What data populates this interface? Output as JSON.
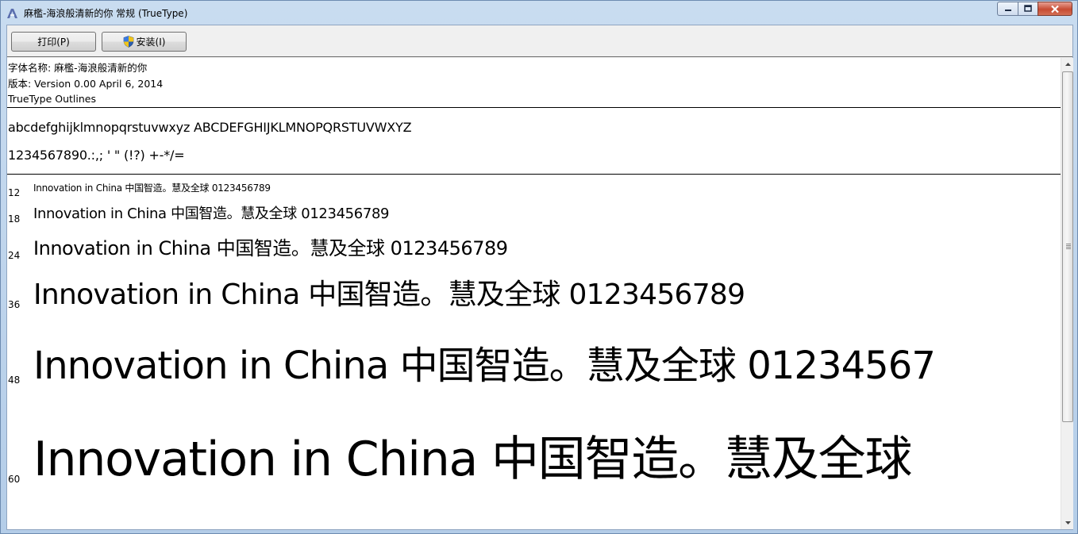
{
  "window": {
    "title": "麻檻-海浪般清新的你 常规 (TrueType)",
    "app_icon": "font-viewer-icon"
  },
  "toolbar": {
    "print_label": "打印(P)",
    "install_label": "安装(I)",
    "install_icon": "uac-shield-icon"
  },
  "font_info": {
    "name_line": "字体名称: 麻檻-海浪般清新的你",
    "version_line": "版本: Version 0.00 April 6, 2014",
    "outline_line": "TrueType Outlines"
  },
  "character_set": {
    "letters": "abcdefghijklmnopqrstuvwxyz ABCDEFGHIJKLMNOPQRSTUVWXYZ",
    "digits_symbols": "1234567890.:,; ' \" (!?) +-*/="
  },
  "samples": [
    {
      "size": "12",
      "latin": "Innovation in China ",
      "cn1": "中国智造",
      "mark": "。",
      "cn2": "慧及全球",
      "digits": " 0123456789"
    },
    {
      "size": "18",
      "latin": "Innovation in China ",
      "cn1": "中国智造",
      "mark": "。",
      "cn2": "慧及全球",
      "digits": " 0123456789"
    },
    {
      "size": "24",
      "latin": "Innovation in China ",
      "cn1": "中国智造",
      "mark": "。",
      "cn2": "慧及全球",
      "digits": " 0123456789"
    },
    {
      "size": "36",
      "latin": "Innovation in China ",
      "cn1": "中国智造",
      "mark": "。",
      "cn2": "慧及全球",
      "digits": " 0123456789"
    },
    {
      "size": "48",
      "latin": "Innovation in China ",
      "cn1": "中国智造",
      "mark": "。",
      "cn2": "慧及全球",
      "digits": " 01234567"
    },
    {
      "size": "60",
      "latin": "Innovation in China ",
      "cn1": "中国智造",
      "mark": "。",
      "cn2": "慧及全球",
      "digits": ""
    }
  ]
}
